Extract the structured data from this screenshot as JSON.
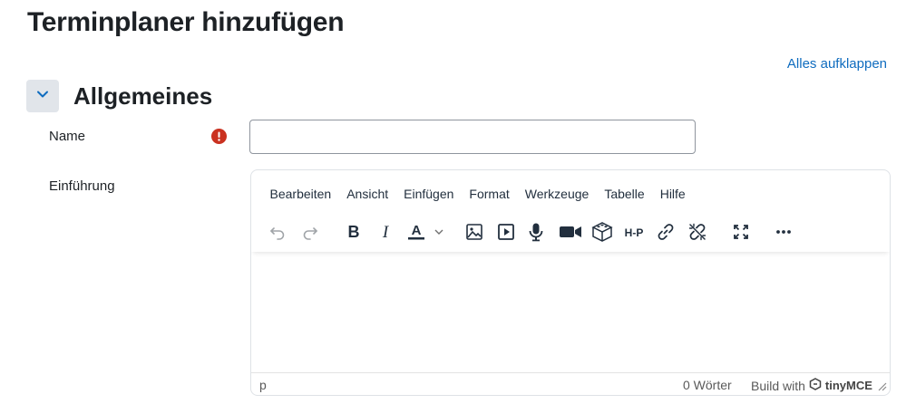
{
  "page": {
    "title": "Terminplaner hinzufügen",
    "expand_all": "Alles aufklappen"
  },
  "section": {
    "title": "Allgemeines"
  },
  "fields": {
    "name": {
      "label": "Name",
      "value": ""
    },
    "intro": {
      "label": "Einführung"
    }
  },
  "editor": {
    "menu": [
      "Bearbeiten",
      "Ansicht",
      "Einfügen",
      "Format",
      "Werkzeuge",
      "Tabelle",
      "Hilfe"
    ],
    "toolbar_icons": [
      "undo-icon",
      "redo-icon",
      "bold-icon",
      "italic-icon",
      "text-color-icon",
      "image-icon",
      "media-icon",
      "microphone-icon",
      "video-camera-icon",
      "content-bank-icon",
      "h5p-icon",
      "link-icon",
      "unlink-icon",
      "fullscreen-icon",
      "more-icon"
    ],
    "status": {
      "path": "p",
      "wordcount": "0 Wörter",
      "build_with": "Build with",
      "brand": "tinyMCE"
    }
  },
  "colors": {
    "accent": "#0f6cbf",
    "required": "#ca3120",
    "toggle_bg": "#e1e5ea"
  }
}
